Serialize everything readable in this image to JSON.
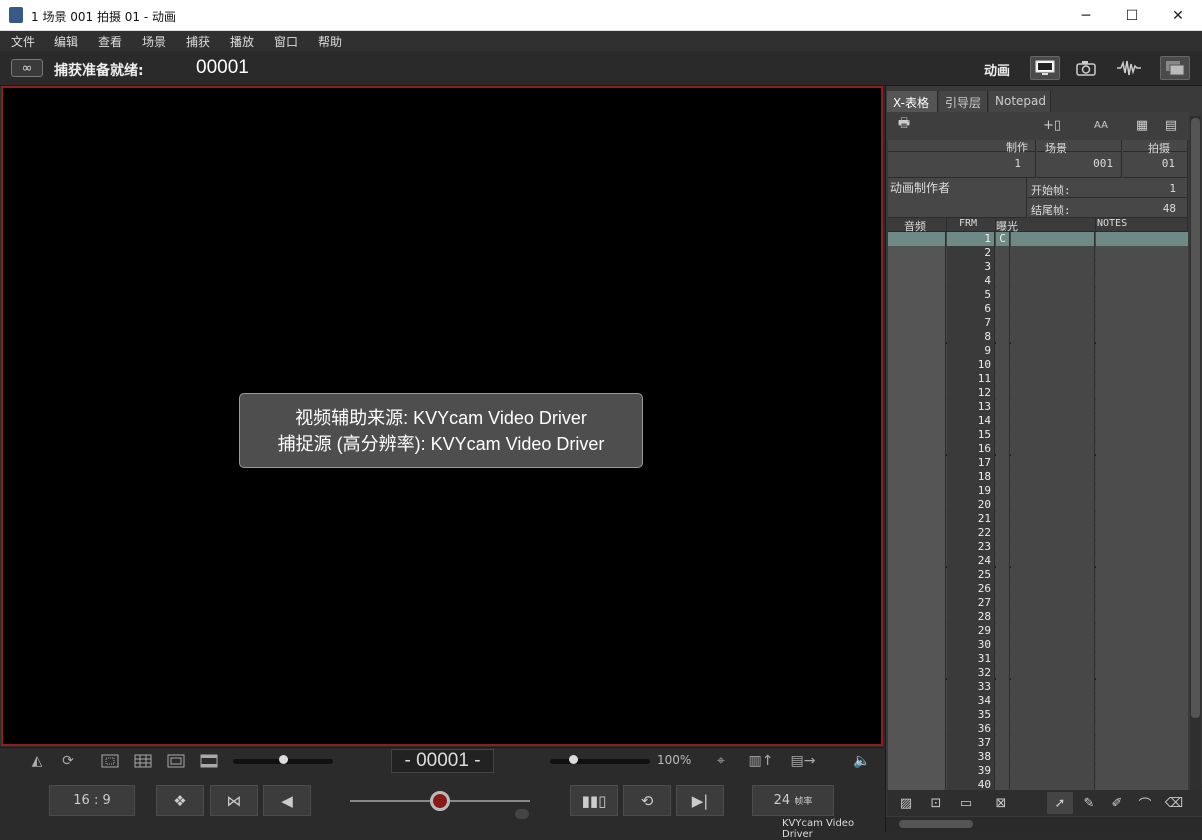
{
  "window": {
    "title": "1 场景 001 拍摄 01 - 动画",
    "minimize_icon": "minimize-icon",
    "maximize_icon": "maximize-icon",
    "close_icon": "close-icon"
  },
  "menu": [
    "文件",
    "编辑",
    "查看",
    "场景",
    "捕获",
    "播放",
    "窗口",
    "帮助"
  ],
  "topbar": {
    "status_label": "捕获准备就绪:",
    "frame": "00001",
    "mode_label": "动画"
  },
  "overlay": {
    "line1": "视频辅助来源: KVYcam Video Driver",
    "line2": "捕捉源 (高分辨率): KVYcam Video Driver"
  },
  "viewer_tools": {
    "center_frame": "- 00001 -",
    "zoom": "100%"
  },
  "transport": {
    "aspect": "16 : 9",
    "fps_value": "24",
    "fps_unit": "帧率",
    "driver": "KVYcam Video Driver",
    "playhead_level": 0.5
  },
  "xsheet": {
    "tabs": [
      "X-表格",
      "引导层",
      "Notepad"
    ],
    "headers": {
      "production": "制作",
      "scene": "场景",
      "take": "拍摄",
      "production_val": "1",
      "scene_val": "001",
      "take_val": "01",
      "animator": "动画制作者",
      "start_label": "开始帧:",
      "start_val": "1",
      "end_label": "结尾帧:",
      "end_val": "48"
    },
    "columns": [
      "音频",
      "FRM",
      "曝光",
      "NOTES"
    ],
    "first_exposure": "C",
    "frames": [
      "1",
      "2",
      "3",
      "4",
      "5",
      "6",
      "7",
      "8",
      "9",
      "10",
      "11",
      "12",
      "13",
      "14",
      "15",
      "16",
      "17",
      "18",
      "19",
      "20",
      "21",
      "22",
      "23",
      "24",
      "25",
      "26",
      "27",
      "28",
      "29",
      "30",
      "31",
      "32",
      "33",
      "34",
      "35",
      "36",
      "37",
      "38",
      "39",
      "40"
    ]
  },
  "colors": {
    "viewport_border": "#8b1e1e",
    "selected_row": "#6f8a86",
    "record": "#8a1a1a"
  }
}
